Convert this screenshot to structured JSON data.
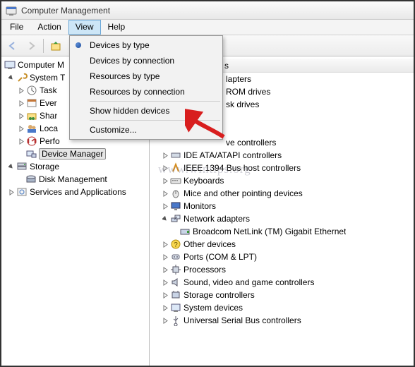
{
  "title": "Computer Management",
  "menubar": {
    "file": "File",
    "action": "Action",
    "view": "View",
    "help": "Help"
  },
  "dropdown": {
    "devices_by_type": "Devices by type",
    "devices_by_connection": "Devices by connection",
    "resources_by_type": "Resources by type",
    "resources_by_connection": "Resources by connection",
    "show_hidden": "Show hidden devices",
    "customize": "Customize..."
  },
  "left_tree": {
    "root": "Computer M",
    "system_tools": "System T",
    "task": "Task",
    "ever": "Ever",
    "shar": "Shar",
    "loca": "Loca",
    "perfo": "Perfo",
    "device_manager": "Device Manager",
    "storage": "Storage",
    "disk_management": "Disk Management",
    "services_apps": "Services and Applications"
  },
  "right_tree": {
    "col_header": "s",
    "lapters": "lapters",
    "rom_drives": "ROM drives",
    "sk_drives": "sk drives",
    "ve_controllers": "ve controllers",
    "ide": "IDE ATA/ATAPI controllers",
    "ieee1394": "IEEE 1394 Bus host controllers",
    "keyboards": "Keyboards",
    "mice": "Mice and other pointing devices",
    "monitors": "Monitors",
    "net_adapters": "Network adapters",
    "broadcom": "Broadcom NetLink (TM) Gigabit Ethernet",
    "other_devices": "Other devices",
    "ports": "Ports (COM & LPT)",
    "processors": "Processors",
    "sound": "Sound, video and game controllers",
    "storage_ctrl": "Storage controllers",
    "system_devices": "System devices",
    "usb": "Universal Serial Bus controllers"
  },
  "watermark": "www.wintips.org"
}
